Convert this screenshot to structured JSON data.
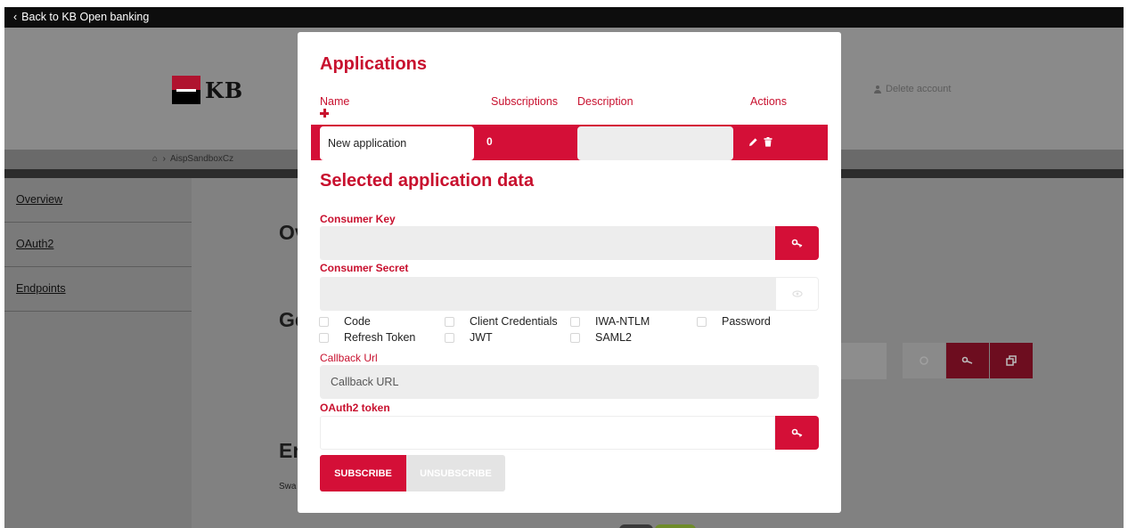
{
  "colors": {
    "brand": "#c8102e",
    "brand_bright": "#d40f37",
    "field_bg": "#ededed"
  },
  "topbar": {
    "back_label": "Back to KB Open banking"
  },
  "header": {
    "logo_text": "KB",
    "delete_account": "Delete account"
  },
  "breadcrumb": {
    "current": "AispSandboxCz"
  },
  "sidebar": {
    "items": [
      {
        "label": "Overview"
      },
      {
        "label": "OAuth2"
      },
      {
        "label": "Endpoints"
      }
    ]
  },
  "background": {
    "heading1": "Ov",
    "heading2": "Ge",
    "heading3": "En",
    "small_text": "Swa"
  },
  "modal": {
    "title": "Applications",
    "columns": {
      "name": "Name",
      "subscriptions": "Subscriptions",
      "description": "Description",
      "actions": "Actions"
    },
    "application": {
      "name": "New application",
      "subscriptions": "0",
      "description": ""
    },
    "selected_title": "Selected application data",
    "consumer_key_label": "Consumer Key",
    "consumer_key_value": "",
    "consumer_secret_label": "Consumer Secret",
    "consumer_secret_value": "",
    "grant_types": [
      {
        "label": "Code",
        "checked": false
      },
      {
        "label": "Client Credentials",
        "checked": false
      },
      {
        "label": "IWA-NTLM",
        "checked": false
      },
      {
        "label": "Password",
        "checked": false
      },
      {
        "label": "Refresh Token",
        "checked": false
      },
      {
        "label": "JWT",
        "checked": false
      },
      {
        "label": "SAML2",
        "checked": false
      }
    ],
    "callback_label": "Callback Url",
    "callback_placeholder": "Callback URL",
    "callback_value": "",
    "oauth_token_label": "OAuth2 token",
    "oauth_token_value": "",
    "subscribe_label": "SUBSCRIBE",
    "unsubscribe_label": "UNSUBSCRIBE"
  }
}
